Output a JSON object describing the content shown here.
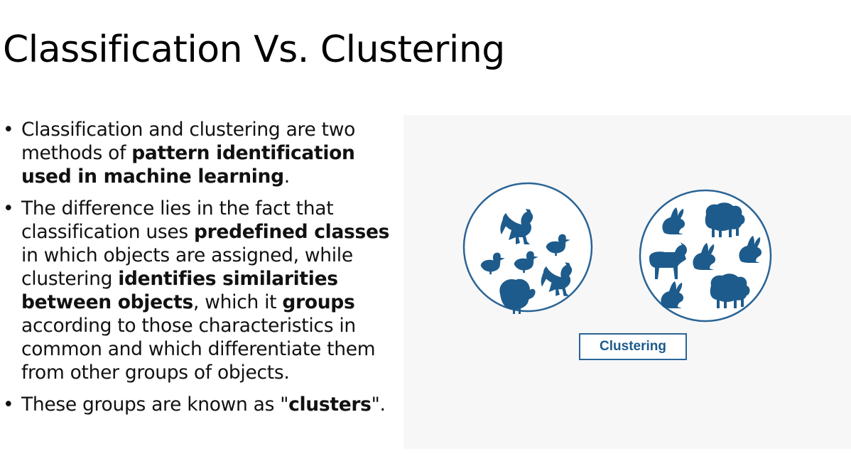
{
  "slide": {
    "title": "Classification Vs. Clustering",
    "bullets": [
      {
        "segments": [
          {
            "text": "Classification and clustering are two methods of ",
            "bold": false
          },
          {
            "text": "pattern identification used in machine learning",
            "bold": true
          },
          {
            "text": ".",
            "bold": false
          }
        ]
      },
      {
        "segments": [
          {
            "text": "The difference lies in the fact that classification uses ",
            "bold": false
          },
          {
            "text": "predefined classes",
            "bold": true
          },
          {
            "text": " in which objects are assigned, while clustering ",
            "bold": false
          },
          {
            "text": "identifies similarities between objects",
            "bold": true
          },
          {
            "text": ", which it ",
            "bold": false
          },
          {
            "text": "groups",
            "bold": true
          },
          {
            "text": " according to those characteristics in common and which differentiate them from other groups of objects.",
            "bold": false
          }
        ]
      },
      {
        "segments": [
          {
            "text": "These groups are known as \"",
            "bold": false
          },
          {
            "text": "clusters",
            "bold": true
          },
          {
            "text": "\".",
            "bold": false
          }
        ]
      }
    ]
  },
  "figure": {
    "label": "Clustering",
    "accent_color": "#2a6496",
    "icon_color": "#1d5b8c",
    "groups": [
      {
        "name": "birds",
        "icons": [
          "rooster-icon",
          "duck-icon",
          "duck-icon",
          "duck-icon",
          "rooster-icon",
          "turkey-icon"
        ]
      },
      {
        "name": "mammals",
        "icons": [
          "rabbit-icon",
          "sheep-icon",
          "goat-icon",
          "rabbit-icon",
          "rabbit-icon",
          "rabbit-icon",
          "sheep-icon"
        ]
      }
    ]
  }
}
